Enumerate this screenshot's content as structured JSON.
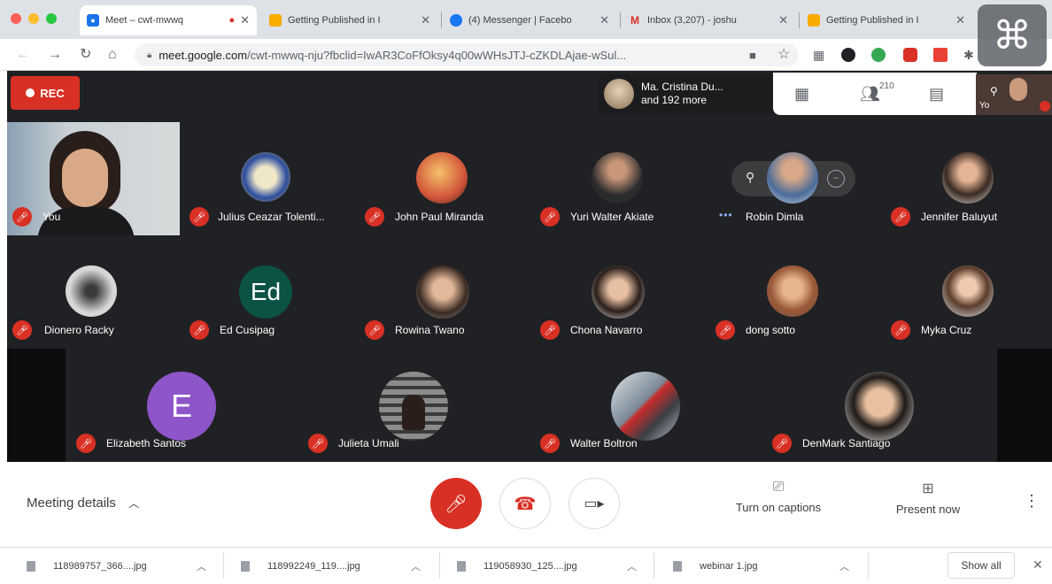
{
  "browser": {
    "tabs": [
      {
        "title": "Meet – cwt-mwwq",
        "favicon_color": "#1a73e8",
        "active": true,
        "recording": true
      },
      {
        "title": "Getting Published in I",
        "favicon_color": "#f9ab00",
        "active": false
      },
      {
        "title": "(4) Messenger | Facebo",
        "favicon_color": "#1877f2",
        "active": false
      },
      {
        "title": "Inbox (3,207) - joshu",
        "favicon_color": "#d93025",
        "active": false
      },
      {
        "title": "Getting Published in I",
        "favicon_color": "#f9ab00",
        "active": false
      }
    ],
    "url_host": "meet.google.com",
    "url_path": "/cwt-mwwq-nju?fbclid=IwAR3CoFfOksy4q00wWHsJTJ-cZKDLAjae-wSul..."
  },
  "meet": {
    "rec_label": "REC",
    "speaker": {
      "line1": "Ma. Cristina Du...",
      "line2": "and 192 more"
    },
    "people_count": "210",
    "self_label": "You",
    "self_thumb_label": "Yo",
    "participants": [
      {
        "name": "Julius Ceazar Tolenti...",
        "row": 1
      },
      {
        "name": "John Paul Miranda",
        "row": 1
      },
      {
        "name": "Yuri Walter Akiate",
        "row": 1
      },
      {
        "name": "Robin Dimla",
        "row": 1
      },
      {
        "name": "Jennifer Baluyut",
        "row": 1
      },
      {
        "name": "Dionero Racky",
        "row": 2
      },
      {
        "name": "Ed Cusipag",
        "row": 2,
        "initials": "Ed",
        "color": "#0b5345"
      },
      {
        "name": "Rowina Twano",
        "row": 2
      },
      {
        "name": "Chona Navarro",
        "row": 2
      },
      {
        "name": "dong sotto",
        "row": 2
      },
      {
        "name": "Myka Cruz",
        "row": 2
      },
      {
        "name": "Elizabeth Santos",
        "row": 3,
        "initials": "E",
        "color": "#8e55c9"
      },
      {
        "name": "Julieta Umali",
        "row": 3
      },
      {
        "name": "Walter Boltron",
        "row": 3
      },
      {
        "name": "DenMark Santiago",
        "row": 3
      }
    ],
    "meeting_details": "Meeting details",
    "captions_label": "Turn on captions",
    "present_label": "Present now"
  },
  "downloads": [
    {
      "file": "118989757_366....jpg"
    },
    {
      "file": "118992249_119....jpg"
    },
    {
      "file": "119058930_125....jpg"
    },
    {
      "file": "webinar 1.jpg"
    }
  ],
  "show_all": "Show all",
  "colors": {
    "accent_red": "#d93025",
    "meet_bg": "#202124"
  }
}
